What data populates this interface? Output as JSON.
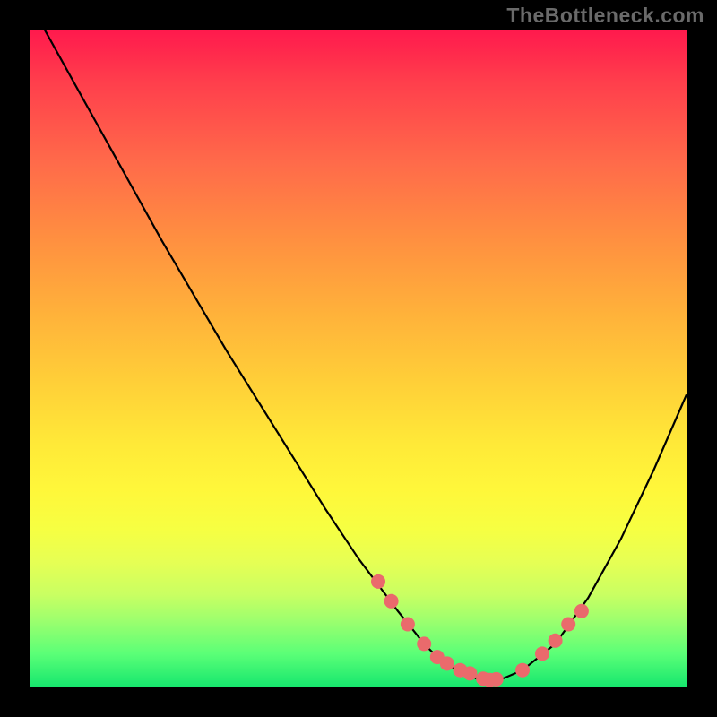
{
  "watermark": "TheBottleneck.com",
  "colors": {
    "background": "#000000",
    "gradient_top": "#ff1a4d",
    "gradient_mid": "#ffe938",
    "gradient_bottom": "#17e76e",
    "curve_stroke": "#000000",
    "marker_fill": "#ea6a6c"
  },
  "chart_data": {
    "type": "line",
    "title": "",
    "xlabel": "",
    "ylabel": "",
    "xlim": [
      0,
      100
    ],
    "ylim": [
      0,
      100
    ],
    "series": [
      {
        "name": "curve",
        "x": [
          0,
          5,
          10,
          15,
          20,
          25,
          30,
          35,
          40,
          45,
          50,
          53,
          56,
          58,
          60,
          62,
          64,
          66,
          68,
          70,
          72,
          75,
          80,
          85,
          90,
          95,
          100
        ],
        "y": [
          104,
          95,
          86,
          77,
          68,
          59.5,
          51,
          43,
          35,
          27,
          19.5,
          15.5,
          11.5,
          9,
          6.5,
          4.5,
          3,
          2,
          1.2,
          1,
          1.2,
          2.5,
          6.5,
          13.5,
          22.5,
          33,
          44.5
        ]
      }
    ],
    "markers": {
      "name": "highlight-points",
      "x": [
        53,
        55,
        57.5,
        60,
        62,
        63.5,
        65.5,
        67,
        69,
        70,
        71,
        75,
        78,
        80,
        82,
        84
      ],
      "y": [
        16,
        13,
        9.5,
        6.5,
        4.5,
        3.5,
        2.5,
        2,
        1.2,
        1,
        1.1,
        2.5,
        5,
        7,
        9.5,
        11.5
      ]
    }
  }
}
